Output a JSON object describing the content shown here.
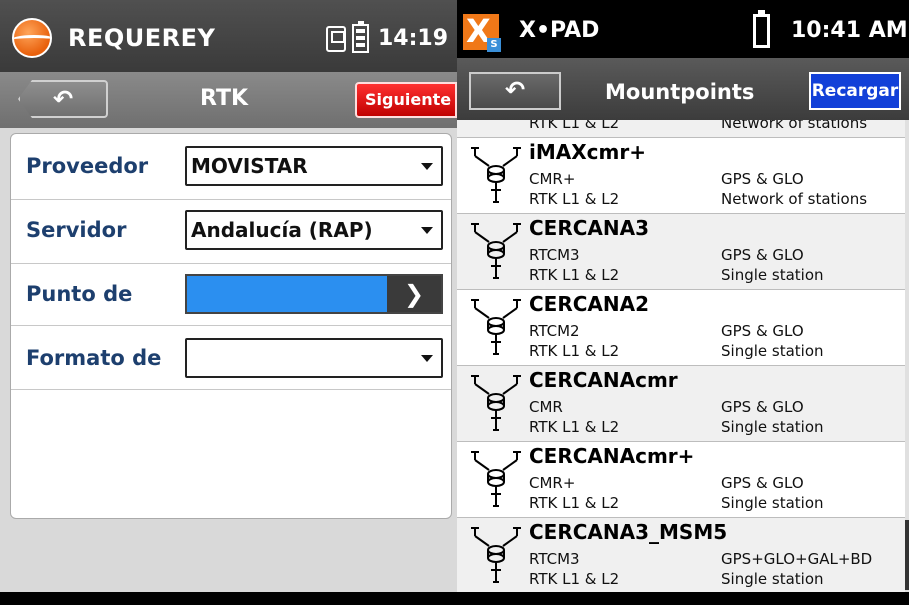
{
  "left_app": {
    "title": "REQUEREY",
    "time": "14:19",
    "back_glyph": "↶",
    "nav_title": "RTK",
    "next_label": "Siguiente",
    "fields": [
      {
        "label": "Proveedor",
        "value": "MOVISTAR"
      },
      {
        "label": "Servidor",
        "value": "Andalucía (RAP)"
      },
      {
        "label": "Punto de",
        "value": ""
      },
      {
        "label": "Formato de",
        "value": ""
      }
    ],
    "go_glyph": "❯",
    "accent_color": "#2b8ff0",
    "next_color": "#e00000",
    "label_color": "#1d3f6e"
  },
  "right_app": {
    "title": "X•PAD",
    "time": "10:41 AM",
    "back_glyph": "↶",
    "nav_title": "Mountpoints",
    "reload_label": "Recargar",
    "reload_color": "#1240d8",
    "partial_row": {
      "carrier": "RTK L1 & L2",
      "type": "Network of stations"
    },
    "mountpoints": [
      {
        "name": "iMAXcmr+",
        "format": "CMR+",
        "systems": "GPS & GLO",
        "carrier": "RTK L1 & L2",
        "type": "Network of stations"
      },
      {
        "name": "CERCANA3",
        "format": "RTCM3",
        "systems": "GPS & GLO",
        "carrier": "RTK L1 & L2",
        "type": "Single station"
      },
      {
        "name": "CERCANA2",
        "format": "RTCM2",
        "systems": "GPS & GLO",
        "carrier": "RTK L1 & L2",
        "type": "Single station"
      },
      {
        "name": "CERCANAcmr",
        "format": "CMR",
        "systems": "GPS & GLO",
        "carrier": "RTK L1 & L2",
        "type": "Single station"
      },
      {
        "name": "CERCANAcmr+",
        "format": "CMR+",
        "systems": "GPS & GLO",
        "carrier": "RTK L1 & L2",
        "type": "Single station"
      },
      {
        "name": "CERCANA3_MSM5",
        "format": "RTCM3",
        "systems": "GPS+GLO+GAL+BD",
        "carrier": "RTK L1 & L2",
        "type": "Single station"
      }
    ]
  }
}
